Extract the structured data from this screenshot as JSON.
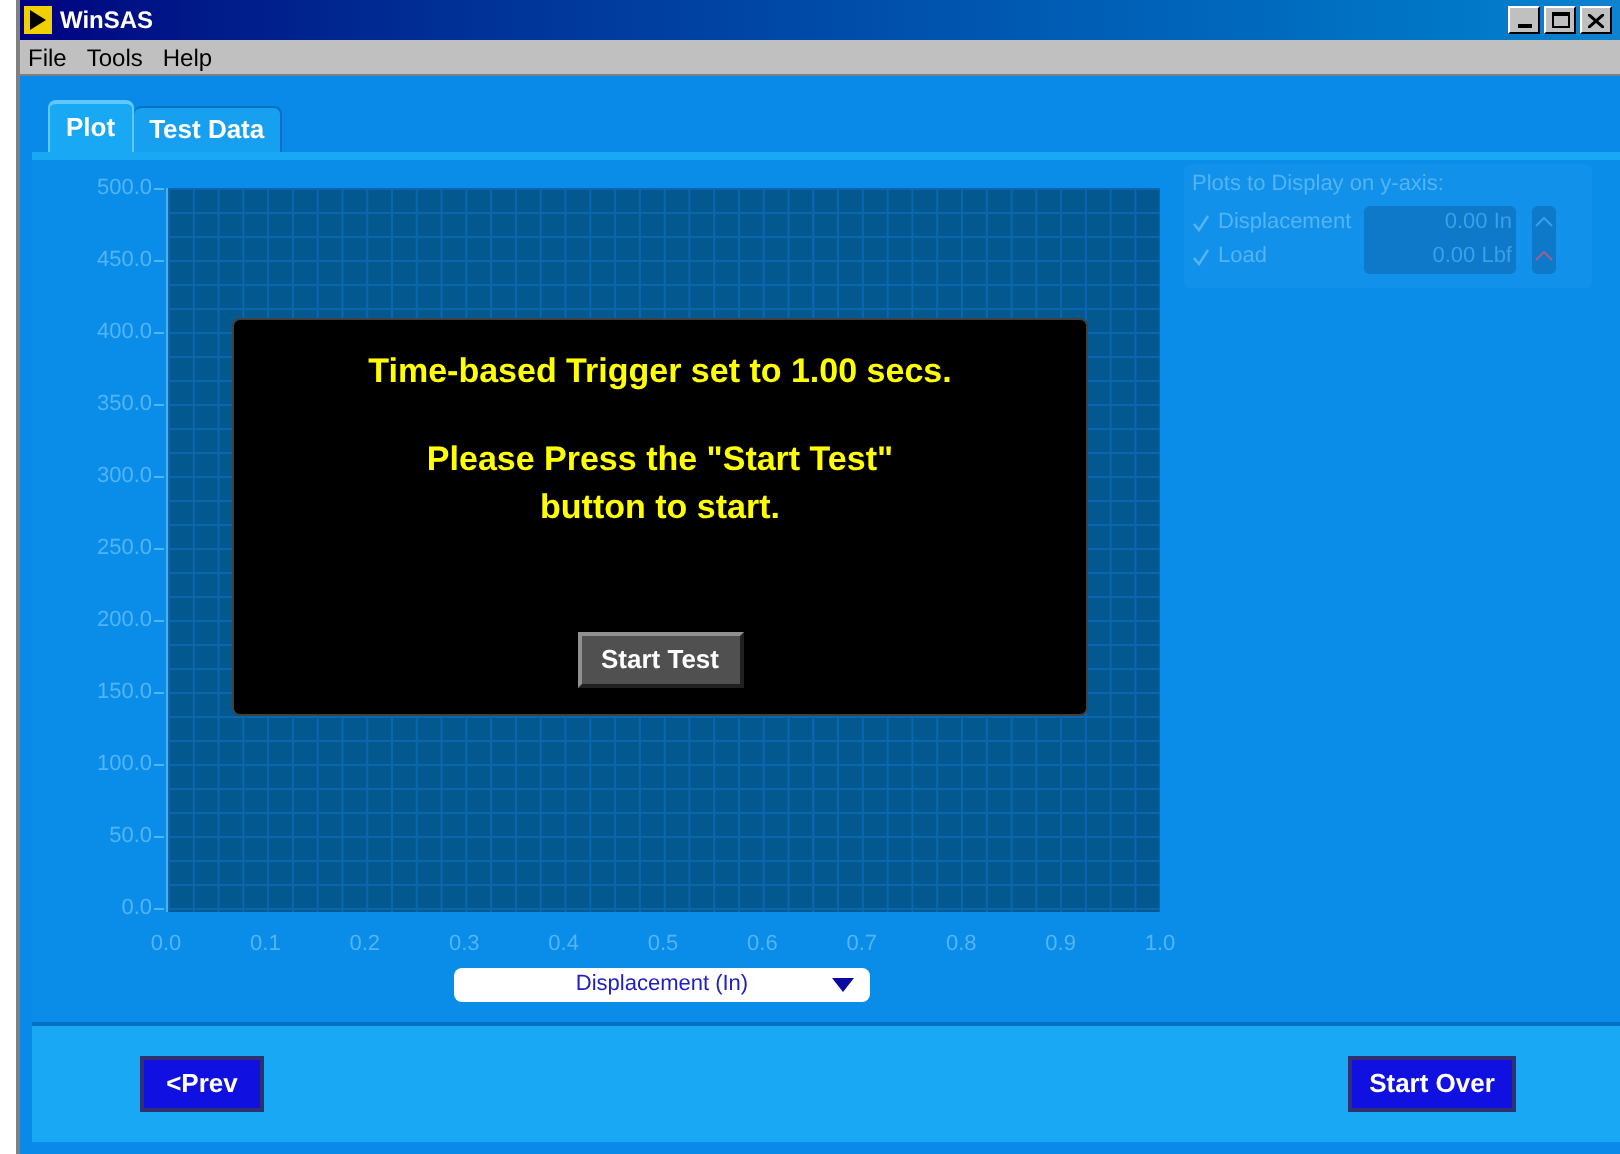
{
  "window": {
    "title": "WinSAS"
  },
  "menu": [
    "File",
    "Tools",
    "Help"
  ],
  "tabs": [
    {
      "label": "Plot",
      "selected": true
    },
    {
      "label": "Test Data",
      "selected": false
    }
  ],
  "plot": {
    "y_axis_labels": [
      "500.0",
      "450.0",
      "400.0",
      "350.0",
      "300.0",
      "250.0",
      "200.0",
      "150.0",
      "100.0",
      "50.0",
      "0.0"
    ],
    "x_axis_labels": [
      "0.0",
      "0.1",
      "0.2",
      "0.3",
      "0.4",
      "0.5",
      "0.6",
      "0.7",
      "0.8",
      "0.9",
      "1.0"
    ],
    "x_axis_selector": "Displacement (In)"
  },
  "message": {
    "lines": [
      "Time-based Trigger set to 1.00 secs.",
      "Please Press the \"Start Test\" button to start."
    ],
    "button": "Start Test"
  },
  "legend": {
    "title": "Plots to Display on y-axis:",
    "items": [
      {
        "label": "Displacement",
        "checked": true,
        "value": "0.00",
        "unit": "In"
      },
      {
        "label": "Load",
        "checked": true,
        "value": "0.00",
        "unit": "Lbf"
      }
    ]
  },
  "buttons": {
    "prev": "<Prev",
    "start_over": "Start Over"
  }
}
